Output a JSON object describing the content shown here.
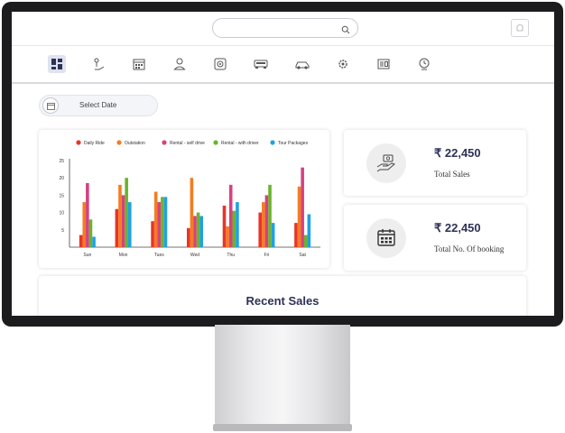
{
  "header": {
    "search_placeholder": ""
  },
  "nav": {
    "items": [
      {
        "name": "dashboard-icon",
        "active": true
      },
      {
        "name": "ride-icon"
      },
      {
        "name": "calendar-grid-icon"
      },
      {
        "name": "user-icon"
      },
      {
        "name": "fingerprint-icon"
      },
      {
        "name": "vehicle-front-icon"
      },
      {
        "name": "car-icon"
      },
      {
        "name": "settings-icon"
      },
      {
        "name": "id-card-icon"
      },
      {
        "name": "clock-user-icon"
      }
    ]
  },
  "date_filter": {
    "label": "Select Date"
  },
  "chart_data": {
    "type": "bar",
    "categories": [
      "Sun",
      "Mon",
      "Tues",
      "Wed",
      "Thu",
      "Fri",
      "Sat"
    ],
    "ylim": [
      0,
      25
    ],
    "yticks": [
      5,
      10,
      15,
      20,
      25
    ],
    "legend_position": "top",
    "grid": false,
    "series": [
      {
        "name": "Daily Ride",
        "color": "#e8342b",
        "values": [
          3.5,
          11,
          7.5,
          5.5,
          12,
          10,
          7
        ]
      },
      {
        "name": "Outstation",
        "color": "#f57c20",
        "values": [
          13,
          18,
          16,
          20,
          6,
          13,
          17.5
        ]
      },
      {
        "name": "Rental - self drive",
        "color": "#d6417f",
        "values": [
          18.5,
          15,
          13,
          9,
          18,
          15,
          23
        ]
      },
      {
        "name": "Rental - with driver",
        "color": "#6ab42d",
        "values": [
          8,
          20,
          14.5,
          10,
          10.5,
          18,
          3.5
        ]
      },
      {
        "name": "Tour Packages",
        "color": "#1fa1e4",
        "values": [
          3,
          13,
          14.5,
          9,
          13,
          7,
          9.5
        ]
      }
    ]
  },
  "stats": [
    {
      "value": "₹ 22,450",
      "label": "Total Sales",
      "icon": "money-hand-icon"
    },
    {
      "value": "₹ 22,450",
      "label": "Total No. Of booking",
      "icon": "booking-calendar-icon"
    }
  ],
  "recent_sales": {
    "title": "Recent Sales"
  }
}
